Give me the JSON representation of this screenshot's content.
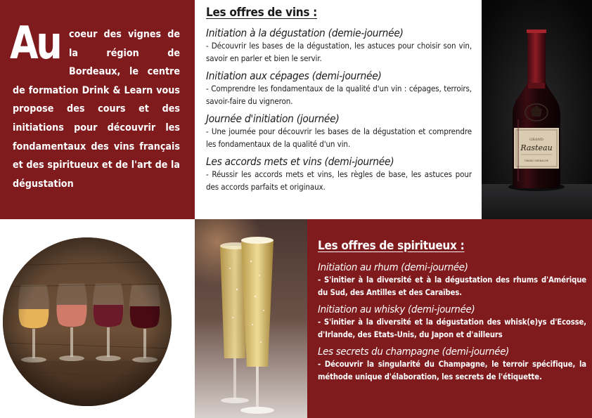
{
  "intro": {
    "big_letters": "Au",
    "text": "coeur des vignes de la région de Bordeaux, le centre de formation Drink & Learn vous propose des cours et des initiations pour découvrir les fondamentaux des vins français et des spiritueux et de l'art de la dégustation"
  },
  "wine": {
    "title": "Les offres de vins :",
    "offers": [
      {
        "title": "Initiation à la dégustation (demie-journée)",
        "desc": "- Découvrir les bases de la dégustation, les astuces pour choisir son vin, savoir en parler et bien le servir."
      },
      {
        "title": "Initiation aux cépages (demi-journée)",
        "desc": "- Comprendre les fondamentaux de la qualité d'un vin : cépages, terroirs, savoir-faire du vigneron."
      },
      {
        "title": "Journée d'initiation (journée)",
        "desc": "- Une journée pour découvrir les bases de la dégustation et comprendre les fondamentaux de la qualité d'un vin."
      },
      {
        "title": "Les accords mets et vins (demi-journée)",
        "desc": "- Réussir les accords mets et vins, les règles de base, les astuces pour des accords parfaits et originaux."
      }
    ]
  },
  "bottle": {
    "label_top": "Rasteau",
    "label_small": "GRAND GRENACHE"
  },
  "spirits": {
    "title": "Les offres de spiritueux :",
    "offers": [
      {
        "title": "Initiation au rhum (demi-journée)",
        "desc": "- S'initier à la diversité et à la dégustation des rhums d'Amérique du Sud, des Antilles et des Caraïbes."
      },
      {
        "title": "Initiation au whisky (demi-journée)",
        "desc": "- S'initier à la diversité et la dégustation des whisk(e)ys d'Ecosse, d'Irlande, des Etats-Unis, du Japon et d'ailleurs"
      },
      {
        "title": "Les secrets du champagne (demi-journée)",
        "desc": "- Découvrir la singularité du Champagne, le terroir spécifique, la méthode unique d'élaboration, les secrets de l'étiquette."
      }
    ]
  },
  "colors": {
    "bordeaux": "#7f1a1d",
    "white": "#ffffff",
    "text_dark": "#1b1b1b"
  }
}
